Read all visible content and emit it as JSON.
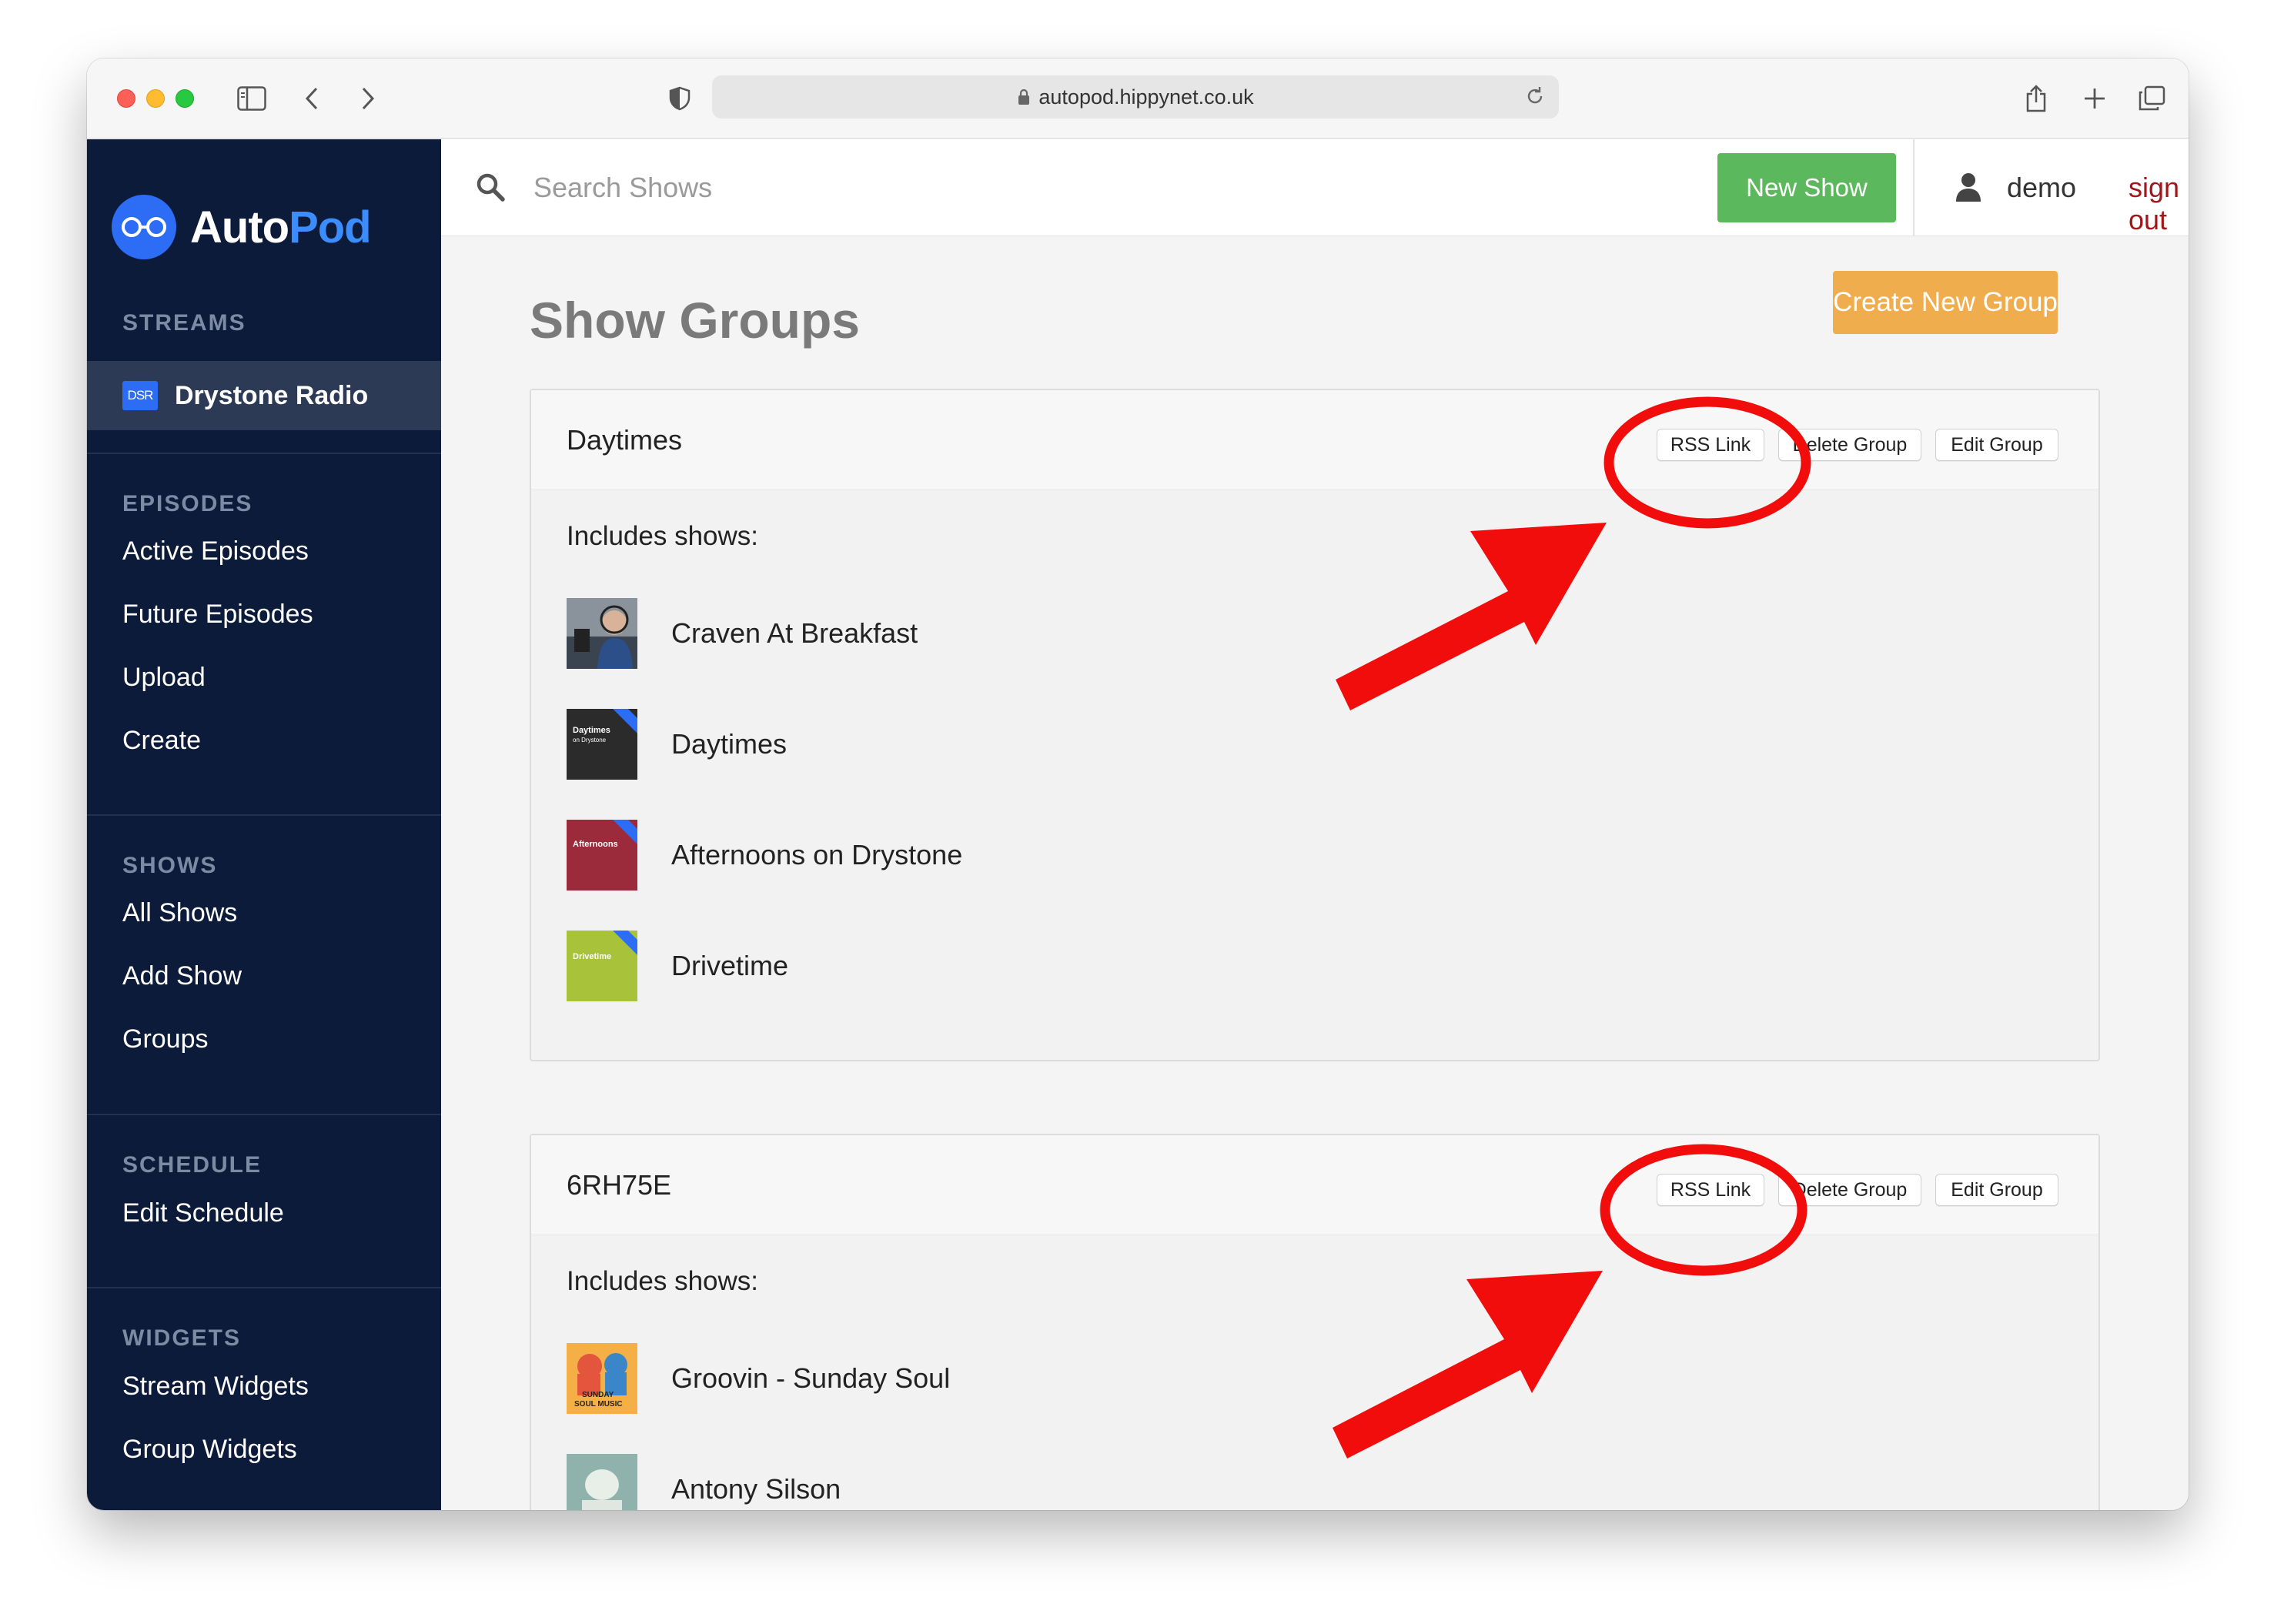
{
  "browser": {
    "url": "autopod.hippynet.co.uk"
  },
  "sidebar": {
    "logo": {
      "part1": "Auto",
      "part2": "Pod"
    },
    "streams_heading": "STREAMS",
    "active_stream": {
      "badge": "DSR",
      "label": "Drystone Radio"
    },
    "episodes_heading": "EPISODES",
    "episodes": [
      "Active Episodes",
      "Future Episodes",
      "Upload",
      "Create"
    ],
    "shows_heading": "SHOWS",
    "shows": [
      "All Shows",
      "Add Show",
      "Groups"
    ],
    "schedule_heading": "SCHEDULE",
    "schedule": [
      "Edit Schedule"
    ],
    "widgets_heading": "WIDGETS",
    "widgets": [
      "Stream Widgets",
      "Group Widgets"
    ]
  },
  "header": {
    "search_placeholder": "Search Shows",
    "new_show_label": "New Show",
    "username": "demo",
    "signout_label": "sign out"
  },
  "main": {
    "title": "Show Groups",
    "create_group_label": "Create New Group",
    "includes_label": "Includes shows:",
    "rss_label": "RSS Link",
    "delete_label": "Delete Group",
    "edit_label": "Edit Group",
    "groups": [
      {
        "name": "Daytimes",
        "shows": [
          {
            "name": "Craven At Breakfast"
          },
          {
            "name": "Daytimes",
            "art_text": "Daytimes",
            "art_sub": "on Drystone"
          },
          {
            "name": "Afternoons on Drystone",
            "art_text": "Afternoons"
          },
          {
            "name": "Drivetime",
            "art_text": "Drivetime"
          }
        ]
      },
      {
        "name": "6RH75E",
        "shows": [
          {
            "name": "Groovin - Sunday Soul",
            "art_text": "SUNDAY",
            "art_sub": "SOUL MUSIC"
          },
          {
            "name": "Antony Silson"
          }
        ]
      }
    ]
  },
  "colors": {
    "sidebar_bg": "#0d1b3a",
    "brand_blue": "#2d6df6",
    "new_show_green": "#5cb85c",
    "create_group_orange": "#f0ad4e",
    "signout_red": "#a1161a",
    "annotation_red": "#f20d0d"
  }
}
